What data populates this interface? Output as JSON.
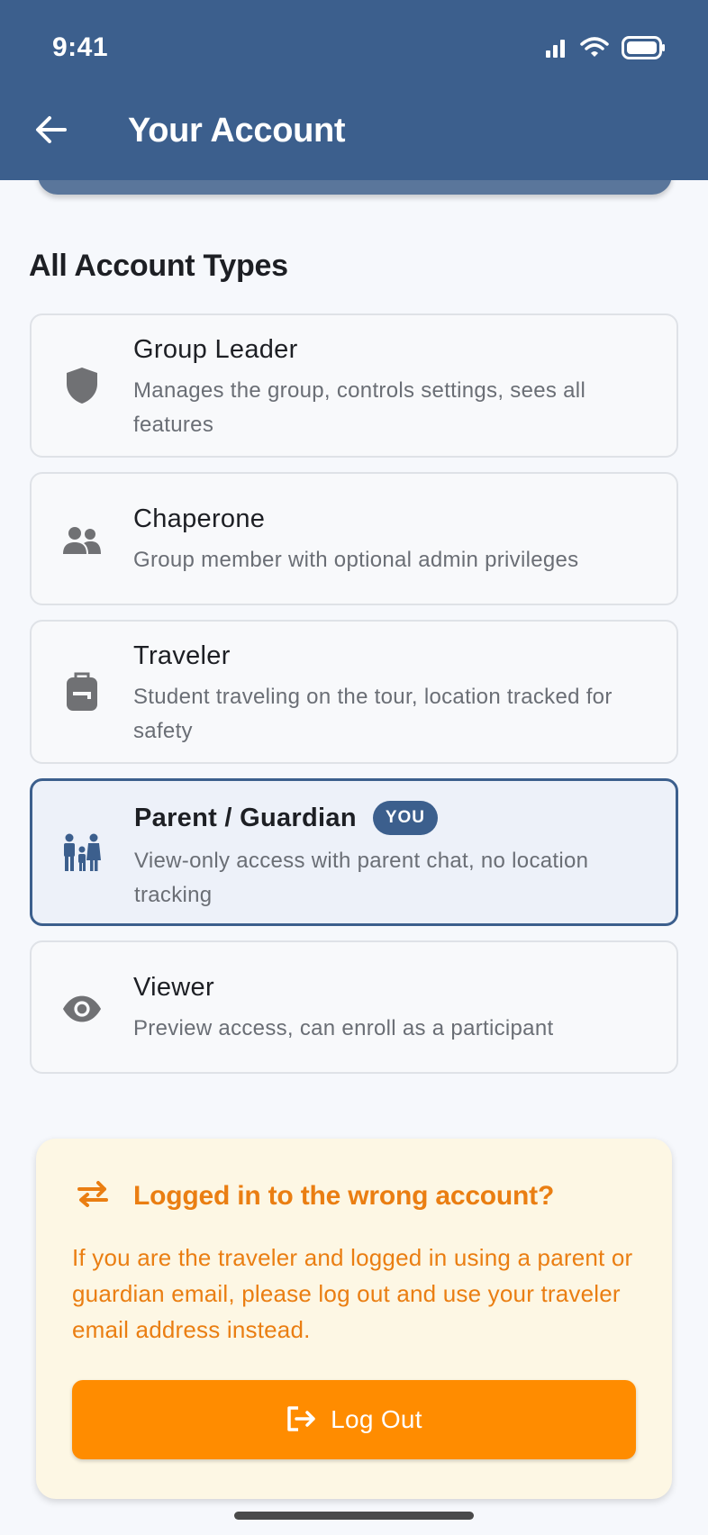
{
  "status_bar": {
    "time": "9:41"
  },
  "app_bar": {
    "title": "Your Account",
    "back_icon": "arrow-left-icon"
  },
  "section": {
    "title": "All Account Types"
  },
  "account_types": [
    {
      "icon": "shield-icon",
      "title": "Group Leader",
      "description": "Manages the group, controls settings, sees all features"
    },
    {
      "icon": "people-icon",
      "title": "Chaperone",
      "description": "Group member with optional admin privileges"
    },
    {
      "icon": "backpack-icon",
      "title": "Traveler",
      "description": "Student traveling on the tour, location tracked for safety"
    },
    {
      "icon": "family-icon",
      "title": "Parent / Guardian",
      "badge": "YOU",
      "description": "View-only access with parent chat, no location tracking",
      "selected": true
    },
    {
      "icon": "eye-icon",
      "title": "Viewer",
      "description": "Preview access, can enroll as a participant"
    }
  ],
  "warning": {
    "icon": "swap-arrows-icon",
    "title": "Logged in to the wrong account?",
    "body": "If you are the traveler and logged in using a parent or guardian email, please log out and use your traveler email address instead.",
    "button_label": "Log Out",
    "button_icon": "logout-icon"
  },
  "colors": {
    "primary": "#3c5f8d",
    "warning_text": "#ea7e12",
    "warning_bg": "#fdf7e4",
    "button": "#ff8c00"
  }
}
